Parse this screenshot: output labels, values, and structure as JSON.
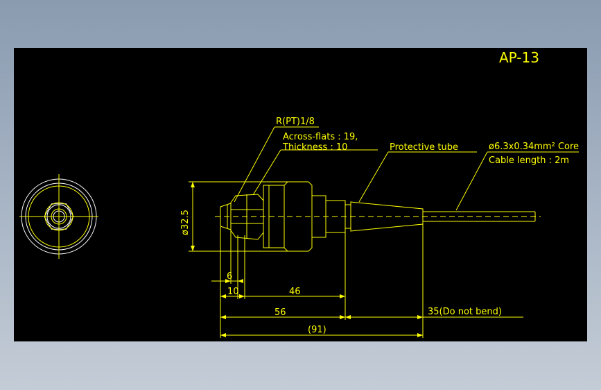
{
  "drawing": {
    "title": "AP-13",
    "labels": {
      "thread": "R(PT)1/8",
      "across_flats": "Across-flats : 19,",
      "thickness": "Thickness : 10",
      "protective_tube": "Protective tube",
      "cable_core": "ø6.3x0.34mm² Core",
      "cable_length": "Cable length : 2m"
    },
    "dimensions": {
      "diameter": "ø32.5",
      "d6": "6",
      "d10": "10",
      "d46": "46",
      "d56": "56",
      "d35": "35(Do not bend)",
      "d91": "(91)"
    }
  },
  "colors": {
    "background": "#000000",
    "drawing_line": "#ffff00",
    "outline": "#ffffff"
  }
}
